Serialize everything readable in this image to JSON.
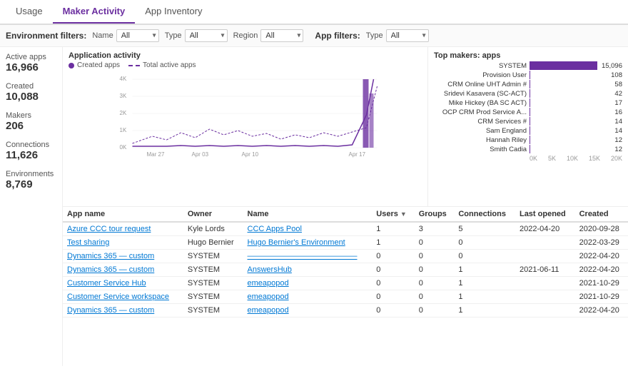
{
  "tabs": [
    {
      "label": "Usage",
      "active": false
    },
    {
      "label": "Maker Activity",
      "active": true
    },
    {
      "label": "App Inventory",
      "active": false
    }
  ],
  "filters": {
    "environment_label": "Environment filters:",
    "name_label": "Name",
    "name_value": "All",
    "type_label": "Type",
    "type_value": "All",
    "region_label": "Region",
    "region_value": "All",
    "app_label": "App filters:",
    "app_type_label": "Type",
    "app_type_value": "All"
  },
  "stats": [
    {
      "label": "Active apps",
      "value": "16,966"
    },
    {
      "label": "Created",
      "value": "10,088"
    },
    {
      "label": "Makers",
      "value": "206"
    },
    {
      "label": "Connections",
      "value": "11,626"
    },
    {
      "label": "Environments",
      "value": "8,769"
    }
  ],
  "line_chart": {
    "title": "Application activity",
    "legend_created": "Created apps",
    "legend_total": "Total active apps",
    "x_labels": [
      "Mar 27",
      "Apr 03",
      "Apr 10",
      "Apr 17"
    ],
    "y_labels": [
      "4K",
      "3K",
      "2K",
      "1K",
      "0K"
    ]
  },
  "bar_chart": {
    "title": "Top makers: apps",
    "items": [
      {
        "name": "SYSTEM",
        "value": 15096,
        "max": 15096
      },
      {
        "name": "Provision User",
        "value": 108,
        "max": 15096
      },
      {
        "name": "CRM Online UHT Admin #",
        "value": 58,
        "max": 15096
      },
      {
        "name": "Sridevi Kasavera (SC-ACT)",
        "value": 42,
        "max": 15096
      },
      {
        "name": "Mike Hickey (BA SC ACT)",
        "value": 17,
        "max": 15096
      },
      {
        "name": "OCP CRM Prod Service A...",
        "value": 16,
        "max": 15096
      },
      {
        "name": "CRM Services #",
        "value": 14,
        "max": 15096
      },
      {
        "name": "Sam England",
        "value": 14,
        "max": 15096
      },
      {
        "name": "Hannah Riley",
        "value": 12,
        "max": 15096
      },
      {
        "name": "Smith Cadia",
        "value": 12,
        "max": 15096
      }
    ],
    "x_labels": [
      "0K",
      "5K",
      "10K",
      "15K",
      "20K"
    ]
  },
  "table": {
    "columns": [
      "App name",
      "Owner",
      "Name",
      "Users",
      "Groups",
      "Connections",
      "Last opened",
      "Created"
    ],
    "rows": [
      {
        "app": "Azure CCC tour request",
        "owner": "Kyle Lords",
        "name": "CCC Apps Pool",
        "users": 1,
        "groups": 3,
        "connections": 5,
        "last_opened": "2022-04-20",
        "created": "2020-09-28"
      },
      {
        "app": "Test sharing",
        "owner": "Hugo Bernier",
        "name": "Hugo Bernier's Environment",
        "users": 1,
        "groups": 0,
        "connections": 0,
        "last_opened": "",
        "created": "2022-03-29"
      },
      {
        "app": "Dynamics 365 — custom",
        "owner": "SYSTEM",
        "name": "——————————————",
        "users": 0,
        "groups": 0,
        "connections": 0,
        "last_opened": "",
        "created": "2022-04-20"
      },
      {
        "app": "Dynamics 365 — custom",
        "owner": "SYSTEM",
        "name": "AnswersHub",
        "users": 0,
        "groups": 0,
        "connections": 1,
        "last_opened": "2021-06-11",
        "created": "2022-04-20"
      },
      {
        "app": "Customer Service Hub",
        "owner": "SYSTEM",
        "name": "emeapopod",
        "users": 0,
        "groups": 0,
        "connections": 1,
        "last_opened": "",
        "created": "2021-10-29"
      },
      {
        "app": "Customer Service workspace",
        "owner": "SYSTEM",
        "name": "emeapopod",
        "users": 0,
        "groups": 0,
        "connections": 1,
        "last_opened": "",
        "created": "2021-10-29"
      },
      {
        "app": "Dynamics 365 — custom",
        "owner": "SYSTEM",
        "name": "emeapopod",
        "users": 0,
        "groups": 0,
        "connections": 1,
        "last_opened": "",
        "created": "2022-04-20"
      }
    ]
  }
}
